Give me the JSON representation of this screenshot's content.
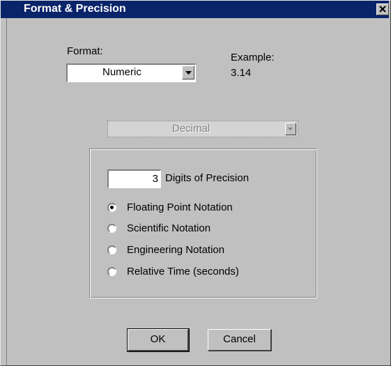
{
  "window": {
    "title": "Format & Precision"
  },
  "format": {
    "label": "Format:",
    "selected": "Numeric"
  },
  "example": {
    "label": "Example:",
    "value": "3.14"
  },
  "representation": {
    "selected": "Decimal",
    "enabled": false
  },
  "precision": {
    "digits": "3",
    "label": "Digits of Precision"
  },
  "notation": {
    "options": [
      {
        "label": "Floating Point Notation",
        "checked": true
      },
      {
        "label": "Scientific Notation",
        "checked": false
      },
      {
        "label": "Engineering Notation",
        "checked": false
      },
      {
        "label": "Relative Time (seconds)",
        "checked": false
      }
    ]
  },
  "buttons": {
    "ok": "OK",
    "cancel": "Cancel"
  },
  "colors": {
    "titlebar": "#0a246a",
    "face": "#c0c0c0"
  }
}
